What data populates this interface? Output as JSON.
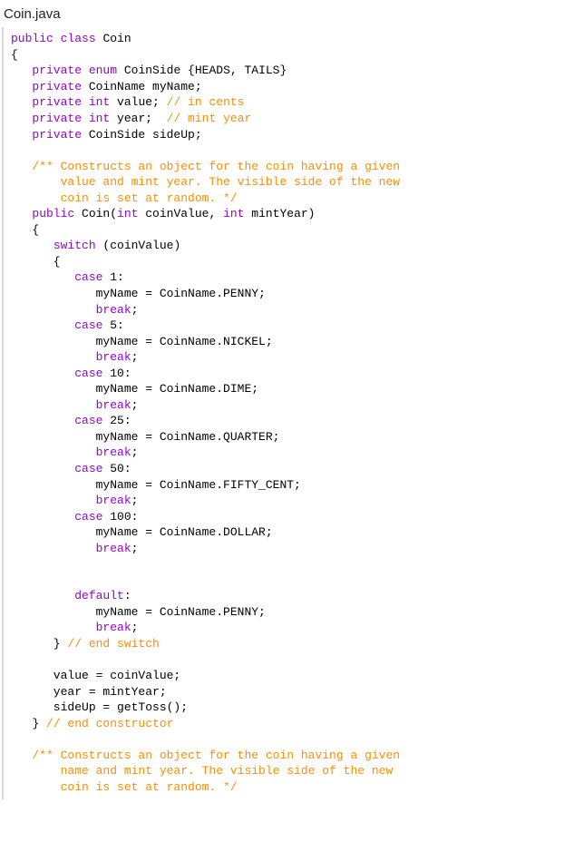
{
  "filename": "Coin.java",
  "code_lines": [
    [
      {
        "c": "kw",
        "t": "public"
      },
      {
        "c": "",
        "t": " "
      },
      {
        "c": "kw",
        "t": "class"
      },
      {
        "c": "",
        "t": " Coin"
      }
    ],
    [
      {
        "c": "",
        "t": "{"
      }
    ],
    [
      {
        "c": "",
        "t": "   "
      },
      {
        "c": "kw",
        "t": "private"
      },
      {
        "c": "",
        "t": " "
      },
      {
        "c": "kw",
        "t": "enum"
      },
      {
        "c": "",
        "t": " CoinSide {HEADS, TAILS}"
      }
    ],
    [
      {
        "c": "",
        "t": "   "
      },
      {
        "c": "kw",
        "t": "private"
      },
      {
        "c": "",
        "t": " CoinName myName;"
      }
    ],
    [
      {
        "c": "",
        "t": "   "
      },
      {
        "c": "kw",
        "t": "private"
      },
      {
        "c": "",
        "t": " "
      },
      {
        "c": "kw",
        "t": "int"
      },
      {
        "c": "",
        "t": " value; "
      },
      {
        "c": "cmt",
        "t": "// in cents"
      }
    ],
    [
      {
        "c": "",
        "t": "   "
      },
      {
        "c": "kw",
        "t": "private"
      },
      {
        "c": "",
        "t": " "
      },
      {
        "c": "kw",
        "t": "int"
      },
      {
        "c": "",
        "t": " year;  "
      },
      {
        "c": "cmt",
        "t": "// mint year"
      }
    ],
    [
      {
        "c": "",
        "t": "   "
      },
      {
        "c": "kw",
        "t": "private"
      },
      {
        "c": "",
        "t": " CoinSide sideUp;"
      }
    ],
    [
      {
        "c": "",
        "t": ""
      }
    ],
    [
      {
        "c": "",
        "t": "   "
      },
      {
        "c": "cmt",
        "t": "/** Constructs an object for the coin having a given"
      }
    ],
    [
      {
        "c": "",
        "t": "       "
      },
      {
        "c": "cmt",
        "t": "value and mint year. The visible side of the new"
      }
    ],
    [
      {
        "c": "",
        "t": "       "
      },
      {
        "c": "cmt",
        "t": "coin is set at random. */"
      }
    ],
    [
      {
        "c": "",
        "t": "   "
      },
      {
        "c": "kw",
        "t": "public"
      },
      {
        "c": "",
        "t": " Coin("
      },
      {
        "c": "kw",
        "t": "int"
      },
      {
        "c": "",
        "t": " coinValue, "
      },
      {
        "c": "kw",
        "t": "int"
      },
      {
        "c": "",
        "t": " mintYear)"
      }
    ],
    [
      {
        "c": "",
        "t": "   {"
      }
    ],
    [
      {
        "c": "",
        "t": "      "
      },
      {
        "c": "kw",
        "t": "switch"
      },
      {
        "c": "",
        "t": " (coinValue)"
      }
    ],
    [
      {
        "c": "",
        "t": "      {"
      }
    ],
    [
      {
        "c": "",
        "t": "         "
      },
      {
        "c": "kw",
        "t": "case"
      },
      {
        "c": "",
        "t": " 1:"
      }
    ],
    [
      {
        "c": "",
        "t": "            myName = CoinName.PENNY;"
      }
    ],
    [
      {
        "c": "",
        "t": "            "
      },
      {
        "c": "kw",
        "t": "break"
      },
      {
        "c": "",
        "t": ";"
      }
    ],
    [
      {
        "c": "",
        "t": "         "
      },
      {
        "c": "kw",
        "t": "case"
      },
      {
        "c": "",
        "t": " 5:"
      }
    ],
    [
      {
        "c": "",
        "t": "            myName = CoinName.NICKEL;"
      }
    ],
    [
      {
        "c": "",
        "t": "            "
      },
      {
        "c": "kw",
        "t": "break"
      },
      {
        "c": "",
        "t": ";"
      }
    ],
    [
      {
        "c": "",
        "t": "         "
      },
      {
        "c": "kw",
        "t": "case"
      },
      {
        "c": "",
        "t": " 10:"
      }
    ],
    [
      {
        "c": "",
        "t": "            myName = CoinName.DIME;"
      }
    ],
    [
      {
        "c": "",
        "t": "            "
      },
      {
        "c": "kw",
        "t": "break"
      },
      {
        "c": "",
        "t": ";"
      }
    ],
    [
      {
        "c": "",
        "t": "         "
      },
      {
        "c": "kw",
        "t": "case"
      },
      {
        "c": "",
        "t": " 25:"
      }
    ],
    [
      {
        "c": "",
        "t": "            myName = CoinName.QUARTER;"
      }
    ],
    [
      {
        "c": "",
        "t": "            "
      },
      {
        "c": "kw",
        "t": "break"
      },
      {
        "c": "",
        "t": ";"
      }
    ],
    [
      {
        "c": "",
        "t": "         "
      },
      {
        "c": "kw",
        "t": "case"
      },
      {
        "c": "",
        "t": " 50:"
      }
    ],
    [
      {
        "c": "",
        "t": "            myName = CoinName.FIFTY_CENT;"
      }
    ],
    [
      {
        "c": "",
        "t": "            "
      },
      {
        "c": "kw",
        "t": "break"
      },
      {
        "c": "",
        "t": ";"
      }
    ],
    [
      {
        "c": "",
        "t": "         "
      },
      {
        "c": "kw",
        "t": "case"
      },
      {
        "c": "",
        "t": " 100:"
      }
    ],
    [
      {
        "c": "",
        "t": "            myName = CoinName.DOLLAR;"
      }
    ],
    [
      {
        "c": "",
        "t": "            "
      },
      {
        "c": "kw",
        "t": "break"
      },
      {
        "c": "",
        "t": ";"
      }
    ],
    [
      {
        "c": "",
        "t": ""
      }
    ],
    [
      {
        "c": "",
        "t": ""
      }
    ],
    [
      {
        "c": "",
        "t": "         "
      },
      {
        "c": "kw",
        "t": "default"
      },
      {
        "c": "",
        "t": ":"
      }
    ],
    [
      {
        "c": "",
        "t": "            myName = CoinName.PENNY;"
      }
    ],
    [
      {
        "c": "",
        "t": "            "
      },
      {
        "c": "kw",
        "t": "break"
      },
      {
        "c": "",
        "t": ";"
      }
    ],
    [
      {
        "c": "",
        "t": "      } "
      },
      {
        "c": "cmt",
        "t": "// end switch"
      }
    ],
    [
      {
        "c": "",
        "t": ""
      }
    ],
    [
      {
        "c": "",
        "t": "      value = coinValue;"
      }
    ],
    [
      {
        "c": "",
        "t": "      year = mintYear;"
      }
    ],
    [
      {
        "c": "",
        "t": "      sideUp = getToss();"
      }
    ],
    [
      {
        "c": "",
        "t": "   } "
      },
      {
        "c": "cmt",
        "t": "// end constructor"
      }
    ],
    [
      {
        "c": "",
        "t": ""
      }
    ],
    [
      {
        "c": "",
        "t": "   "
      },
      {
        "c": "cmt",
        "t": "/** Constructs an object for the coin having a given"
      }
    ],
    [
      {
        "c": "",
        "t": "       "
      },
      {
        "c": "cmt",
        "t": "name and mint year. The visible side of the new"
      }
    ],
    [
      {
        "c": "",
        "t": "       "
      },
      {
        "c": "cmt",
        "t": "coin is set at random. */"
      }
    ]
  ]
}
